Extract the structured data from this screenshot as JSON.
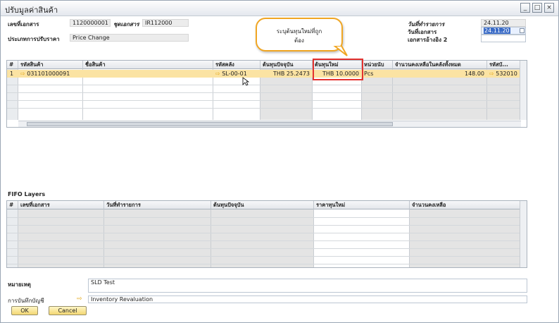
{
  "window": {
    "title": "ปรับมูลค่าสินค้า",
    "controls": [
      "_",
      "□",
      "×"
    ]
  },
  "header": {
    "doc_no_label": "เลขที่เอกสาร",
    "doc_no": "1120000001",
    "series_label": "ชุดเอกสาร",
    "series": "IR112000",
    "revaluation_type_label": "ประเภทการปรับราคา",
    "revaluation_type": "Price Change",
    "posting_date_label": "วันที่ทำรายการ",
    "posting_date": "24.11.20",
    "doc_date_label": "วันที่เอกสาร",
    "doc_date": "24.11.20",
    "ref2_label": "เอกสารอ้างอิง 2",
    "ref2": ""
  },
  "callout": {
    "text_line1": "ระบุต้นทุนใหม่ที่ถูก",
    "text_line2": "ต้อง"
  },
  "items_table": {
    "columns": [
      "#",
      "รหัสสินค้า",
      "ชื่อสินค้า",
      "รหัสคลัง",
      "ต้นทุนปัจจุบัน",
      "ต้นทุนใหม่",
      "หน่วยนับ",
      "จำนวนคงเหลือในคลังทั้งหมด",
      "รหัสบั..."
    ],
    "row": {
      "num": "1",
      "item_code": "031101000091",
      "item_name": "",
      "warehouse": "SL-00-01",
      "current_cost": "THB 25.2473",
      "new_cost": "THB 10.0000",
      "uom": "Pcs",
      "on_hand": "148.00",
      "account": "532010"
    }
  },
  "fifo": {
    "title": "FIFO Layers",
    "columns": [
      "#",
      "เลขที่เอกสาร",
      "วันที่ทำรายการ",
      "ต้นทุนปัจจุบัน",
      "ราคาทุนใหม่",
      "จำนวนคงเหลือ"
    ]
  },
  "footer": {
    "remarks_label": "หมายเหตุ",
    "remarks": "SLD Test",
    "journal_label": "การบันทึกบัญชี",
    "journal": "Inventory Revaluation",
    "ok": "OK",
    "cancel": "Cancel"
  },
  "colors": {
    "selected_row": "#fbe3a3",
    "highlight": "#e3322f",
    "callout_border": "#f0a623",
    "button": "#f3d772"
  }
}
